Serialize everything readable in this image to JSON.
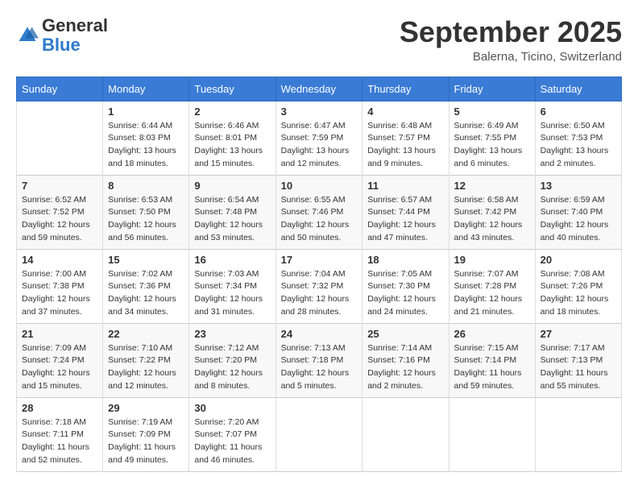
{
  "logo": {
    "general": "General",
    "blue": "Blue"
  },
  "header": {
    "month": "September 2025",
    "location": "Balerna, Ticino, Switzerland"
  },
  "days_of_week": [
    "Sunday",
    "Monday",
    "Tuesday",
    "Wednesday",
    "Thursday",
    "Friday",
    "Saturday"
  ],
  "weeks": [
    [
      {
        "day": "",
        "sunrise": "",
        "sunset": "",
        "daylight": ""
      },
      {
        "day": "1",
        "sunrise": "Sunrise: 6:44 AM",
        "sunset": "Sunset: 8:03 PM",
        "daylight": "Daylight: 13 hours and 18 minutes."
      },
      {
        "day": "2",
        "sunrise": "Sunrise: 6:46 AM",
        "sunset": "Sunset: 8:01 PM",
        "daylight": "Daylight: 13 hours and 15 minutes."
      },
      {
        "day": "3",
        "sunrise": "Sunrise: 6:47 AM",
        "sunset": "Sunset: 7:59 PM",
        "daylight": "Daylight: 13 hours and 12 minutes."
      },
      {
        "day": "4",
        "sunrise": "Sunrise: 6:48 AM",
        "sunset": "Sunset: 7:57 PM",
        "daylight": "Daylight: 13 hours and 9 minutes."
      },
      {
        "day": "5",
        "sunrise": "Sunrise: 6:49 AM",
        "sunset": "Sunset: 7:55 PM",
        "daylight": "Daylight: 13 hours and 6 minutes."
      },
      {
        "day": "6",
        "sunrise": "Sunrise: 6:50 AM",
        "sunset": "Sunset: 7:53 PM",
        "daylight": "Daylight: 13 hours and 2 minutes."
      }
    ],
    [
      {
        "day": "7",
        "sunrise": "Sunrise: 6:52 AM",
        "sunset": "Sunset: 7:52 PM",
        "daylight": "Daylight: 12 hours and 59 minutes."
      },
      {
        "day": "8",
        "sunrise": "Sunrise: 6:53 AM",
        "sunset": "Sunset: 7:50 PM",
        "daylight": "Daylight: 12 hours and 56 minutes."
      },
      {
        "day": "9",
        "sunrise": "Sunrise: 6:54 AM",
        "sunset": "Sunset: 7:48 PM",
        "daylight": "Daylight: 12 hours and 53 minutes."
      },
      {
        "day": "10",
        "sunrise": "Sunrise: 6:55 AM",
        "sunset": "Sunset: 7:46 PM",
        "daylight": "Daylight: 12 hours and 50 minutes."
      },
      {
        "day": "11",
        "sunrise": "Sunrise: 6:57 AM",
        "sunset": "Sunset: 7:44 PM",
        "daylight": "Daylight: 12 hours and 47 minutes."
      },
      {
        "day": "12",
        "sunrise": "Sunrise: 6:58 AM",
        "sunset": "Sunset: 7:42 PM",
        "daylight": "Daylight: 12 hours and 43 minutes."
      },
      {
        "day": "13",
        "sunrise": "Sunrise: 6:59 AM",
        "sunset": "Sunset: 7:40 PM",
        "daylight": "Daylight: 12 hours and 40 minutes."
      }
    ],
    [
      {
        "day": "14",
        "sunrise": "Sunrise: 7:00 AM",
        "sunset": "Sunset: 7:38 PM",
        "daylight": "Daylight: 12 hours and 37 minutes."
      },
      {
        "day": "15",
        "sunrise": "Sunrise: 7:02 AM",
        "sunset": "Sunset: 7:36 PM",
        "daylight": "Daylight: 12 hours and 34 minutes."
      },
      {
        "day": "16",
        "sunrise": "Sunrise: 7:03 AM",
        "sunset": "Sunset: 7:34 PM",
        "daylight": "Daylight: 12 hours and 31 minutes."
      },
      {
        "day": "17",
        "sunrise": "Sunrise: 7:04 AM",
        "sunset": "Sunset: 7:32 PM",
        "daylight": "Daylight: 12 hours and 28 minutes."
      },
      {
        "day": "18",
        "sunrise": "Sunrise: 7:05 AM",
        "sunset": "Sunset: 7:30 PM",
        "daylight": "Daylight: 12 hours and 24 minutes."
      },
      {
        "day": "19",
        "sunrise": "Sunrise: 7:07 AM",
        "sunset": "Sunset: 7:28 PM",
        "daylight": "Daylight: 12 hours and 21 minutes."
      },
      {
        "day": "20",
        "sunrise": "Sunrise: 7:08 AM",
        "sunset": "Sunset: 7:26 PM",
        "daylight": "Daylight: 12 hours and 18 minutes."
      }
    ],
    [
      {
        "day": "21",
        "sunrise": "Sunrise: 7:09 AM",
        "sunset": "Sunset: 7:24 PM",
        "daylight": "Daylight: 12 hours and 15 minutes."
      },
      {
        "day": "22",
        "sunrise": "Sunrise: 7:10 AM",
        "sunset": "Sunset: 7:22 PM",
        "daylight": "Daylight: 12 hours and 12 minutes."
      },
      {
        "day": "23",
        "sunrise": "Sunrise: 7:12 AM",
        "sunset": "Sunset: 7:20 PM",
        "daylight": "Daylight: 12 hours and 8 minutes."
      },
      {
        "day": "24",
        "sunrise": "Sunrise: 7:13 AM",
        "sunset": "Sunset: 7:18 PM",
        "daylight": "Daylight: 12 hours and 5 minutes."
      },
      {
        "day": "25",
        "sunrise": "Sunrise: 7:14 AM",
        "sunset": "Sunset: 7:16 PM",
        "daylight": "Daylight: 12 hours and 2 minutes."
      },
      {
        "day": "26",
        "sunrise": "Sunrise: 7:15 AM",
        "sunset": "Sunset: 7:14 PM",
        "daylight": "Daylight: 11 hours and 59 minutes."
      },
      {
        "day": "27",
        "sunrise": "Sunrise: 7:17 AM",
        "sunset": "Sunset: 7:13 PM",
        "daylight": "Daylight: 11 hours and 55 minutes."
      }
    ],
    [
      {
        "day": "28",
        "sunrise": "Sunrise: 7:18 AM",
        "sunset": "Sunset: 7:11 PM",
        "daylight": "Daylight: 11 hours and 52 minutes."
      },
      {
        "day": "29",
        "sunrise": "Sunrise: 7:19 AM",
        "sunset": "Sunset: 7:09 PM",
        "daylight": "Daylight: 11 hours and 49 minutes."
      },
      {
        "day": "30",
        "sunrise": "Sunrise: 7:20 AM",
        "sunset": "Sunset: 7:07 PM",
        "daylight": "Daylight: 11 hours and 46 minutes."
      },
      {
        "day": "",
        "sunrise": "",
        "sunset": "",
        "daylight": ""
      },
      {
        "day": "",
        "sunrise": "",
        "sunset": "",
        "daylight": ""
      },
      {
        "day": "",
        "sunrise": "",
        "sunset": "",
        "daylight": ""
      },
      {
        "day": "",
        "sunrise": "",
        "sunset": "",
        "daylight": ""
      }
    ]
  ]
}
